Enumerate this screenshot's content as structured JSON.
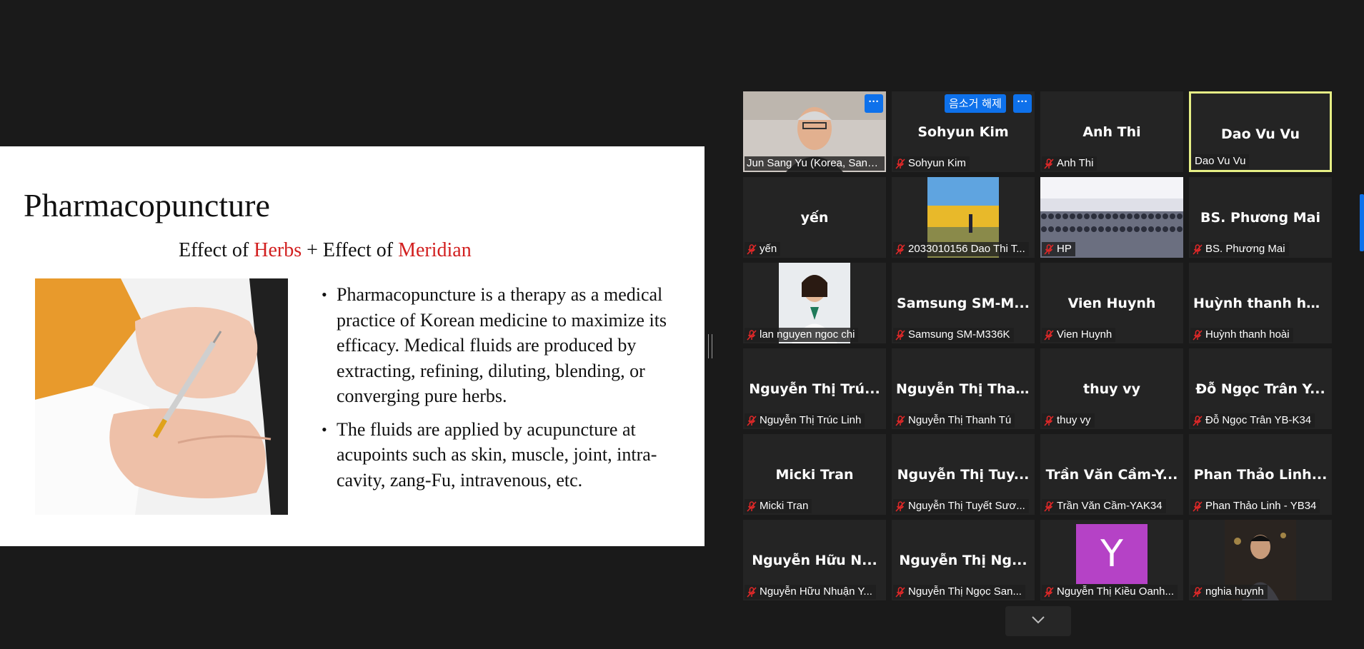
{
  "slide": {
    "title": "Pharmacopuncture",
    "subtitle": {
      "part1": "Effect of ",
      "herbs": "Herbs",
      "part2": " + Effect of ",
      "meridian": "Meridian"
    },
    "bullets": [
      "Pharmacopuncture is a therapy as a medical practice of Korean medicine to maximize its efficacy. Medical fluids are produced by extracting, refining, diluting, blending, or converging pure herbs.",
      "The fluids are applied by acupuncture at acupoints such as skin, muscle, joint, intra-cavity, zang-Fu, intravenous, etc."
    ]
  },
  "gallery": {
    "more_label": "···",
    "unmute_label": "음소거 해제",
    "tiles": [
      {
        "big": "",
        "label": "Jun Sang Yu (Korea, Sangj...",
        "muted": false,
        "video": "man"
      },
      {
        "big": "Sohyun Kim",
        "label": "Sohyun Kim",
        "muted": true
      },
      {
        "big": "Anh Thi",
        "label": "Anh Thi",
        "muted": true
      },
      {
        "big": "Dao Vu Vu",
        "label": "Dao Vu Vu",
        "muted": false,
        "active": true
      },
      {
        "big": "yến",
        "label": "yến",
        "muted": true
      },
      {
        "big": "",
        "label": "2033010156 Dao Thi T...",
        "muted": true,
        "video": "outdoor"
      },
      {
        "big": "",
        "label": "HP",
        "muted": true,
        "video": "hall"
      },
      {
        "big": "BS. Phương Mai",
        "label": "BS. Phương Mai",
        "muted": true
      },
      {
        "big": "",
        "label": "lan nguyen ngoc chi",
        "muted": true,
        "video": "doctor"
      },
      {
        "big": "Samsung SM-M...",
        "label": "Samsung SM-M336K",
        "muted": true
      },
      {
        "big": "Vien Huynh",
        "label": "Vien Huynh",
        "muted": true
      },
      {
        "big": "Huỳnh thanh hoài",
        "label": "Huỳnh thanh hoài",
        "muted": true
      },
      {
        "big": "Nguyễn Thị Trú...",
        "label": "Nguyễn Thị Trúc Linh",
        "muted": true
      },
      {
        "big": "Nguyễn Thị Tha...",
        "label": "Nguyễn Thị Thanh Tú",
        "muted": true
      },
      {
        "big": "thuy vy",
        "label": "thuy vy",
        "muted": true
      },
      {
        "big": "Đỗ Ngọc Trân Y...",
        "label": "Đỗ Ngọc Trân YB-K34",
        "muted": true
      },
      {
        "big": "Micki Tran",
        "label": "Micki Tran",
        "muted": true
      },
      {
        "big": "Nguyễn Thị Tuy...",
        "label": "Nguyễn Thị Tuyết Sươ...",
        "muted": true
      },
      {
        "big": "Trần Văn Cầm-Y...",
        "label": "Trần Văn Cầm-YAK34",
        "muted": true
      },
      {
        "big": "Phan Thảo Linh...",
        "label": "Phan Thảo Linh - YB34",
        "muted": true
      },
      {
        "big": "Nguyễn Hữu N...",
        "label": "Nguyễn Hữu Nhuận Y...",
        "muted": true
      },
      {
        "big": "Nguyễn Thị Ng...",
        "label": "Nguyễn Thị Ngọc San...",
        "muted": true
      },
      {
        "big": "",
        "label": "Nguyễn Thị Kiều Oanh...",
        "muted": true,
        "avatar": "Y"
      },
      {
        "big": "",
        "label": "nghia huynh",
        "muted": true,
        "video": "night"
      }
    ]
  },
  "colors": {
    "accent": "#0e71eb",
    "active_speaker": "#e6ef85",
    "muted_icon": "#e02828",
    "highlight_red": "#d21f1f"
  }
}
